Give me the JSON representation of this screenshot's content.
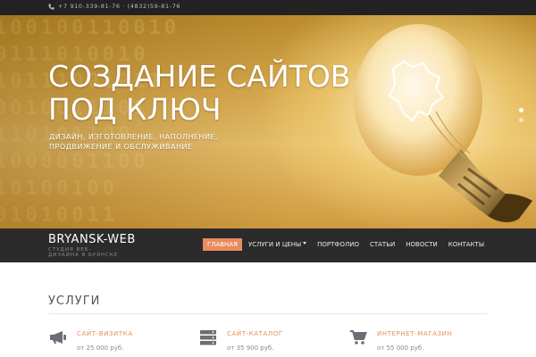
{
  "topbar": {
    "phones": "+7 910-339-81-76  ·  (4832)59-81-76",
    "phone_icon": "phone-icon"
  },
  "hero": {
    "title": "СОЗДАНИЕ САЙТОВ ПОД КЛЮЧ",
    "subtitle": "ДИЗАЙН, ИЗГОТОВЛЕНИЕ, НАПОЛНЕНИЕ, ПРОДВИЖЕНИЕ И ОБСЛУЖИВАНИЕ",
    "background_text": [
      "100100110010",
      "0111010010",
      "10111001011",
      "0010011101",
      "110101100",
      "1000001100",
      "10100100",
      "01010011"
    ],
    "image": "light-bulb-image",
    "slider_dots": 2,
    "active_dot": 0
  },
  "navbar": {
    "brand": "BRYANSK-WEB",
    "tagline": "СТУДИЯ ВЕБ-ДИЗАЙНА В БРЯНСКЕ",
    "menu": [
      {
        "label": "ГЛАВНАЯ",
        "active": true
      },
      {
        "label": "УСЛУГИ И ЦЕНЫ",
        "dropdown": true
      },
      {
        "label": "ПОРТФОЛИО"
      },
      {
        "label": "СТАТЬИ"
      },
      {
        "label": "НОВОСТИ"
      },
      {
        "label": "КОНТАКТЫ"
      }
    ]
  },
  "services": {
    "title": "УСЛУГИ",
    "items": [
      {
        "name": "САЙТ-ВИЗИТКА",
        "price": "от 25 000 руб.",
        "icon": "megaphone-icon"
      },
      {
        "name": "САЙТ-КАТАЛОГ",
        "price": "от 35 900 руб.",
        "icon": "server-icon"
      },
      {
        "name": "ИНТЕРНЕТ-МАГАЗИН",
        "price": "от 55 000 руб.",
        "icon": "shopping-cart-icon"
      }
    ]
  },
  "colors": {
    "accent": "#e98b5f",
    "topbar": "#222222",
    "navbar": "#2b2b2b",
    "icon": "#6b6f75"
  }
}
